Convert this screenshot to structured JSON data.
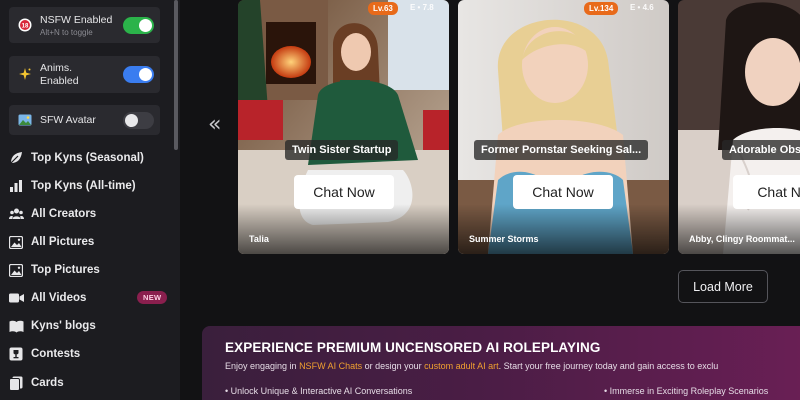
{
  "toggles": {
    "nsfw": {
      "label": "NSFW Enabled",
      "hint": "Alt+N to toggle",
      "state": "on",
      "color": "#2bb34a"
    },
    "anims": {
      "label_line1": "Anims.",
      "label_line2": "Enabled",
      "state": "on",
      "color": "#3a7df0"
    },
    "sfw_avatar": {
      "label": "SFW Avatar",
      "state": "off"
    }
  },
  "nav": {
    "items": [
      {
        "label": "Top Kyns (Seasonal)",
        "icon": "leaf-icon"
      },
      {
        "label": "Top Kyns (All-time)",
        "icon": "bar-chart-icon"
      },
      {
        "label": "All Creators",
        "icon": "users-icon"
      },
      {
        "label": "All Pictures",
        "icon": "image-icon"
      },
      {
        "label": "Top Pictures",
        "icon": "image-icon"
      },
      {
        "label": "All Videos",
        "icon": "video-icon",
        "badge": "NEW"
      },
      {
        "label": "Kyns' blogs",
        "icon": "book-icon"
      },
      {
        "label": "Contests",
        "icon": "trophy-icon"
      },
      {
        "label": "Cards",
        "icon": "cards-icon"
      }
    ]
  },
  "carousel": {
    "prev_icon": "chevron-double-left-icon",
    "cards": [
      {
        "level": "Lv.63",
        "stat": "E • 7.8",
        "title": "Twin Sister Startup",
        "button": "Chat Now",
        "creator": "Talia"
      },
      {
        "level": "Lv.134",
        "stat": "E • 4.6",
        "title": "Former Pornstar Seeking Sal...",
        "button": "Chat Now",
        "creator": "Summer Storms"
      },
      {
        "level": "",
        "stat": "",
        "title": "Adorable Obs",
        "button": "Chat No",
        "creator": "Abby, Clingy Roommat..."
      }
    ],
    "load_more": "Load More"
  },
  "promo": {
    "heading": "EXPERIENCE PREMIUM UNCENSORED AI ROLEPLAYING",
    "sub_1": "Enjoy engaging in ",
    "sub_link_1": "NSFW AI Chats",
    "sub_2": " or design your ",
    "sub_link_2": "custom adult AI art",
    "sub_3": ". Start your free journey today and gain access to exclu",
    "bullet_1": "• Unlock Unique & Interactive AI Conversations",
    "bullet_2": "• Immerse in Exciting Roleplay Scenarios"
  }
}
